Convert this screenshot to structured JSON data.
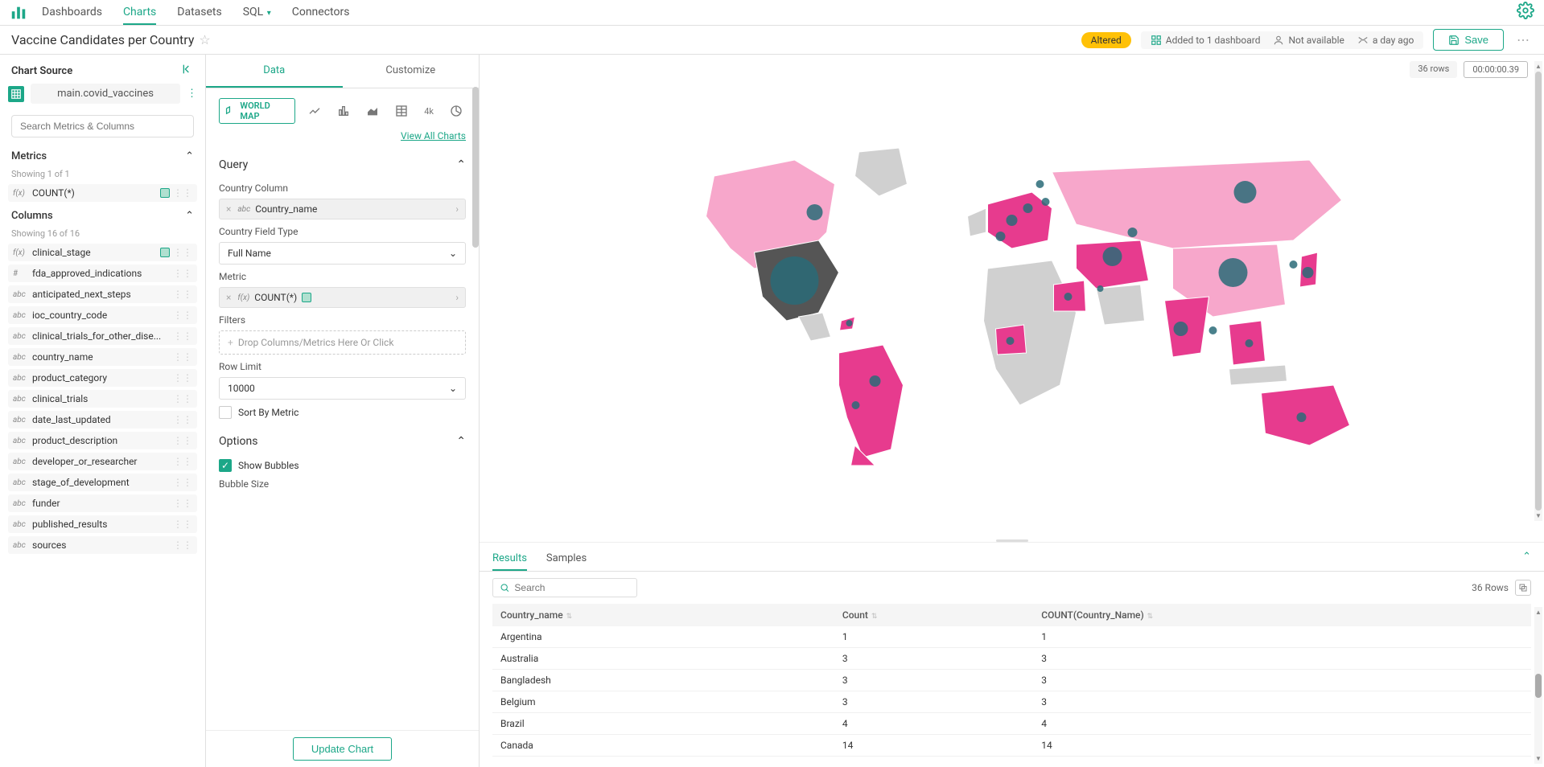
{
  "nav": {
    "items": [
      "Dashboards",
      "Charts",
      "Datasets",
      "SQL",
      "Connectors"
    ],
    "active": "Charts"
  },
  "header": {
    "title": "Vaccine Candidates per Country",
    "altered": "Altered",
    "dashboard_text": "Added to 1 dashboard",
    "owner_text": "Not available",
    "time_text": "a day ago",
    "save": "Save"
  },
  "left": {
    "source_label": "Chart Source",
    "source_name": "main.covid_vaccines",
    "search_placeholder": "Search Metrics & Columns",
    "metrics_label": "Metrics",
    "metrics_showing": "Showing 1 of 1",
    "metrics": [
      {
        "type": "f(x)",
        "name": "COUNT(*)",
        "badge": true
      }
    ],
    "columns_label": "Columns",
    "columns_showing": "Showing 16 of 16",
    "columns": [
      {
        "type": "f(x)",
        "name": "clinical_stage",
        "badge": true
      },
      {
        "type": "#",
        "name": "fda_approved_indications"
      },
      {
        "type": "abc",
        "name": "anticipated_next_steps"
      },
      {
        "type": "abc",
        "name": "ioc_country_code"
      },
      {
        "type": "abc",
        "name": "clinical_trials_for_other_dise..."
      },
      {
        "type": "abc",
        "name": "country_name"
      },
      {
        "type": "abc",
        "name": "product_category"
      },
      {
        "type": "abc",
        "name": "clinical_trials"
      },
      {
        "type": "abc",
        "name": "date_last_updated"
      },
      {
        "type": "abc",
        "name": "product_description"
      },
      {
        "type": "abc",
        "name": "developer_or_researcher"
      },
      {
        "type": "abc",
        "name": "stage_of_development"
      },
      {
        "type": "abc",
        "name": "funder"
      },
      {
        "type": "abc",
        "name": "published_results"
      },
      {
        "type": "abc",
        "name": "sources"
      }
    ]
  },
  "mid": {
    "tab_data": "Data",
    "tab_customize": "Customize",
    "viz_active": "WORLD MAP",
    "viz_4k": "4k",
    "view_all": "View All Charts",
    "query_label": "Query",
    "country_col_label": "Country Column",
    "country_col_value": "Country_name",
    "country_type_label": "Country Field Type",
    "country_type_value": "Full Name",
    "metric_label": "Metric",
    "metric_value": "COUNT(*)",
    "filters_label": "Filters",
    "filters_placeholder": "Drop Columns/Metrics Here Or Click",
    "row_limit_label": "Row Limit",
    "row_limit_value": "10000",
    "sort_label": "Sort By Metric",
    "options_label": "Options",
    "show_bubbles_label": "Show Bubbles",
    "bubble_size_label": "Bubble Size",
    "update_btn": "Update Chart"
  },
  "right": {
    "rows_text": "36 rows",
    "time_text": "00:00:00.39",
    "tab_results": "Results",
    "tab_samples": "Samples",
    "search_placeholder": "Search",
    "row_count": "36 Rows",
    "table": {
      "headers": [
        "Country_name",
        "Count",
        "COUNT(Country_Name)"
      ],
      "rows": [
        [
          "Argentina",
          "1",
          "1"
        ],
        [
          "Australia",
          "3",
          "3"
        ],
        [
          "Bangladesh",
          "3",
          "3"
        ],
        [
          "Belgium",
          "3",
          "3"
        ],
        [
          "Brazil",
          "4",
          "4"
        ],
        [
          "Canada",
          "14",
          "14"
        ]
      ]
    }
  },
  "chart_data": {
    "type": "world_map_bubble",
    "title": "Vaccine Candidates per Country",
    "metric": "COUNT(*)",
    "countries": [
      {
        "name": "Argentina",
        "count": 1
      },
      {
        "name": "Australia",
        "count": 3
      },
      {
        "name": "Bangladesh",
        "count": 3
      },
      {
        "name": "Belgium",
        "count": 3
      },
      {
        "name": "Brazil",
        "count": 4
      },
      {
        "name": "Canada",
        "count": 14
      }
    ],
    "total_rows": 36
  }
}
